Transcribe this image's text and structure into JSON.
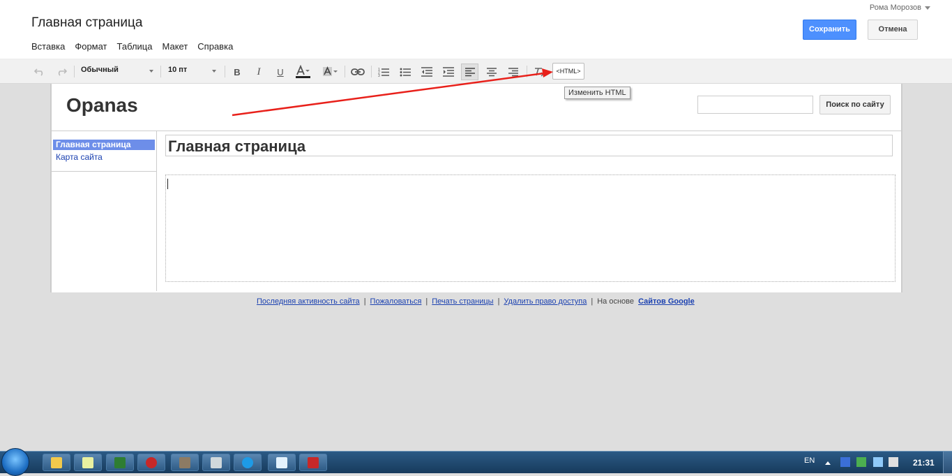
{
  "editor": {
    "page_title": "Главная страница",
    "user_name": "Рома Морозов",
    "save_label": "Сохранить",
    "cancel_label": "Отмена",
    "menu": [
      "Вставка",
      "Формат",
      "Таблица",
      "Макет",
      "Справка"
    ]
  },
  "toolbar": {
    "style_value": "Обычный",
    "size_value": "10 пт",
    "bold": "B",
    "italic": "I",
    "underline": "U",
    "html_label": "<HTML>",
    "tooltip": "Изменить HTML"
  },
  "site": {
    "name": "Opanas",
    "search_button": "Поиск по сайту",
    "search_value": "",
    "nav": [
      "Главная страница",
      "Карта сайта"
    ],
    "content_title": "Главная страница"
  },
  "footer": {
    "links": [
      "Последняя активность сайта",
      "Пожаловаться",
      "Печать страницы",
      "Удалить право доступа"
    ],
    "powered_prefix": "На основе",
    "powered_link": "Сайтов Google"
  },
  "taskbar": {
    "lang": "EN",
    "clock": "21:31",
    "apps": [
      "explorer-icon",
      "notepad-icon",
      "monitor-icon",
      "media-player-icon",
      "gimp-icon",
      "window-switcher-icon",
      "skype-icon",
      "documents-icon",
      "filezilla-icon"
    ]
  },
  "colors": {
    "accent": "#4d90fe",
    "annotation_arrow": "#e8201a",
    "nav_active": "#6d8ee9",
    "link": "#1a40b0"
  }
}
